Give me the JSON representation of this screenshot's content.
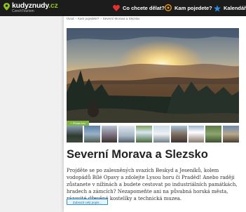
{
  "header": {
    "logo_text": "kudyznudy",
    "logo_tld": ".cz",
    "logo_sub": "CzechTourism",
    "nav": [
      {
        "label": "Co chcete dělat?",
        "icon": "heart-icon"
      },
      {
        "label": "Kam pojedete?",
        "icon": "location-pin-icon"
      },
      {
        "label": "Kalendář a",
        "icon": "star-icon"
      }
    ]
  },
  "breadcrumb": [
    "Úvod",
    "Kam pojedete?",
    "Severní Morava a Slezsko"
  ],
  "gallery": {
    "button_label": "+ Přidat foto",
    "thumbnail_count": 10
  },
  "page": {
    "title": "Severní Morava a Slezsko",
    "description": "Projděte se po zalesněných svazích Beskyd a Jeseníků, kolem vodopádů Bílé Opavy a zdolejte Lysou horu či Praděd! Anebo raději zůstanete v nížinách a budete cestovat po industriálních památkách, hradech a zámcích? Nezapomeňte ani na půvabná horská města, rázovité dřevěné kostelíky a technická muzea.",
    "more_button": "Zobrazit celý popis..."
  },
  "colors": {
    "topbar": "#1c1c1c",
    "accent_green": "#7cb342",
    "heart": "#e5302f",
    "pin": "#f2a21b",
    "star": "#2b8ee8",
    "link_blue": "#2a90d0"
  }
}
